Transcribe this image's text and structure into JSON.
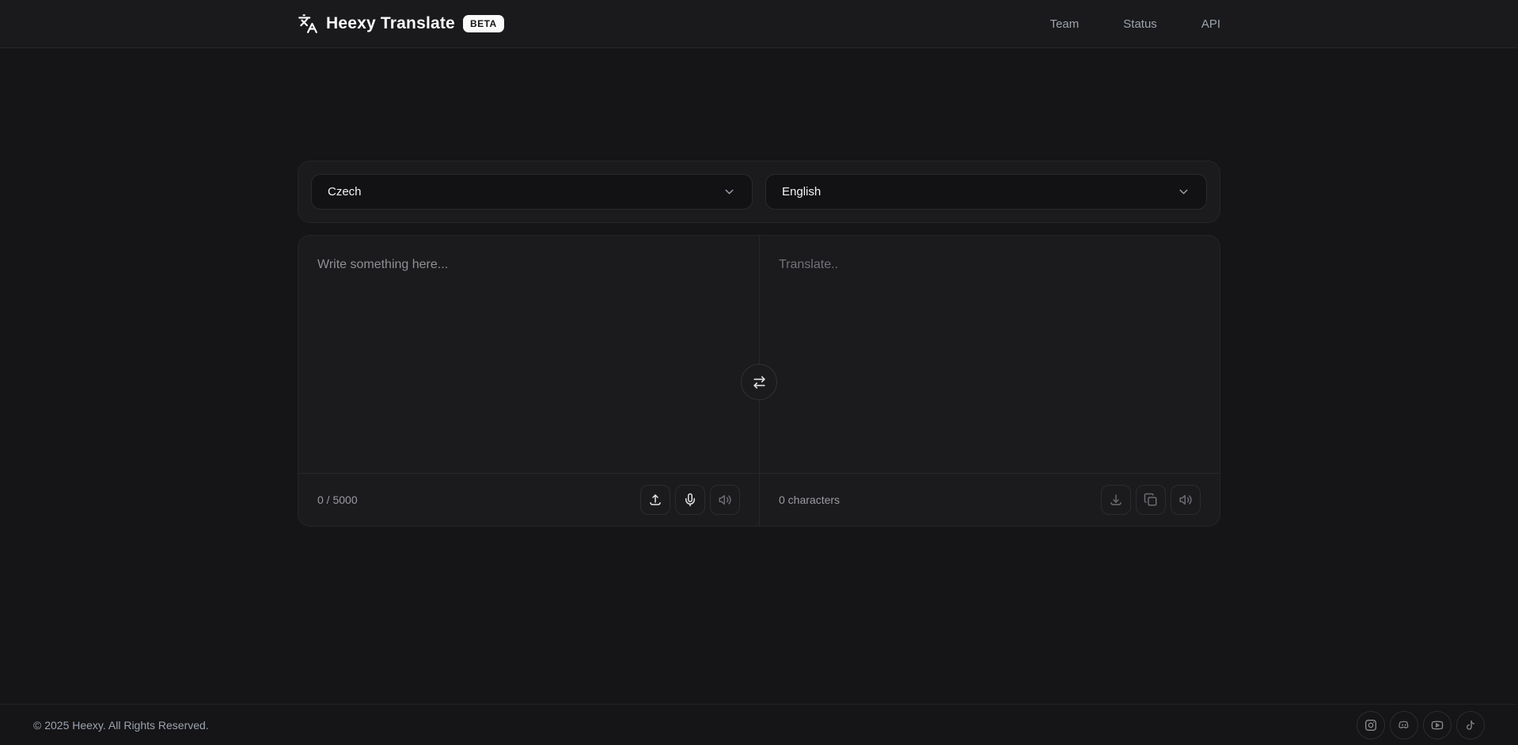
{
  "header": {
    "brand": "Heexy Translate",
    "badge": "BETA",
    "nav": [
      {
        "label": "Team"
      },
      {
        "label": "Status"
      },
      {
        "label": "API"
      }
    ]
  },
  "translator": {
    "source_language": "Czech",
    "target_language": "English",
    "source_placeholder": "Write something here...",
    "target_placeholder": "Translate..",
    "source_counter": "0 / 5000",
    "target_counter": "0 characters",
    "source_icons": [
      "upload-icon",
      "microphone-icon",
      "speaker-icon"
    ],
    "target_icons": [
      "download-icon",
      "copy-icon",
      "speaker-icon"
    ],
    "swap_icon": "swap-arrows-icon"
  },
  "footer": {
    "copyright": "© 2025 Heexy. All Rights Reserved.",
    "social": [
      {
        "name": "instagram"
      },
      {
        "name": "discord"
      },
      {
        "name": "youtube"
      },
      {
        "name": "tiktok"
      }
    ]
  },
  "colors": {
    "page_bg": "#151517",
    "header_bg": "#1a1a1c",
    "panel_bg": "#1b1b1d",
    "border": "#27272b",
    "badge_bg": "#fafafa",
    "badge_text": "#161618",
    "muted_text": "#9ca3af"
  }
}
